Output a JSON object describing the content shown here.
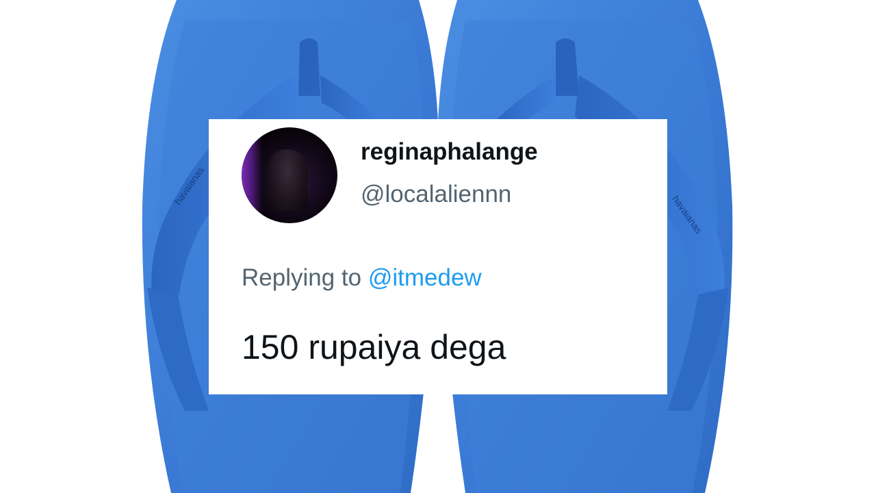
{
  "tweet": {
    "display_name": "reginaphalange",
    "handle": "@localaliennn",
    "replying_prefix": "Replying to",
    "replying_handle": "@itmedew",
    "text": "150 rupaiya dega"
  },
  "background": {
    "subject": "blue flip-flops",
    "strap_print": "havaianas"
  },
  "colors": {
    "sandal_blue": "#3f7fd6",
    "link_blue": "#1d9bf0",
    "secondary_text": "#536471",
    "primary_text": "#0f1419"
  }
}
